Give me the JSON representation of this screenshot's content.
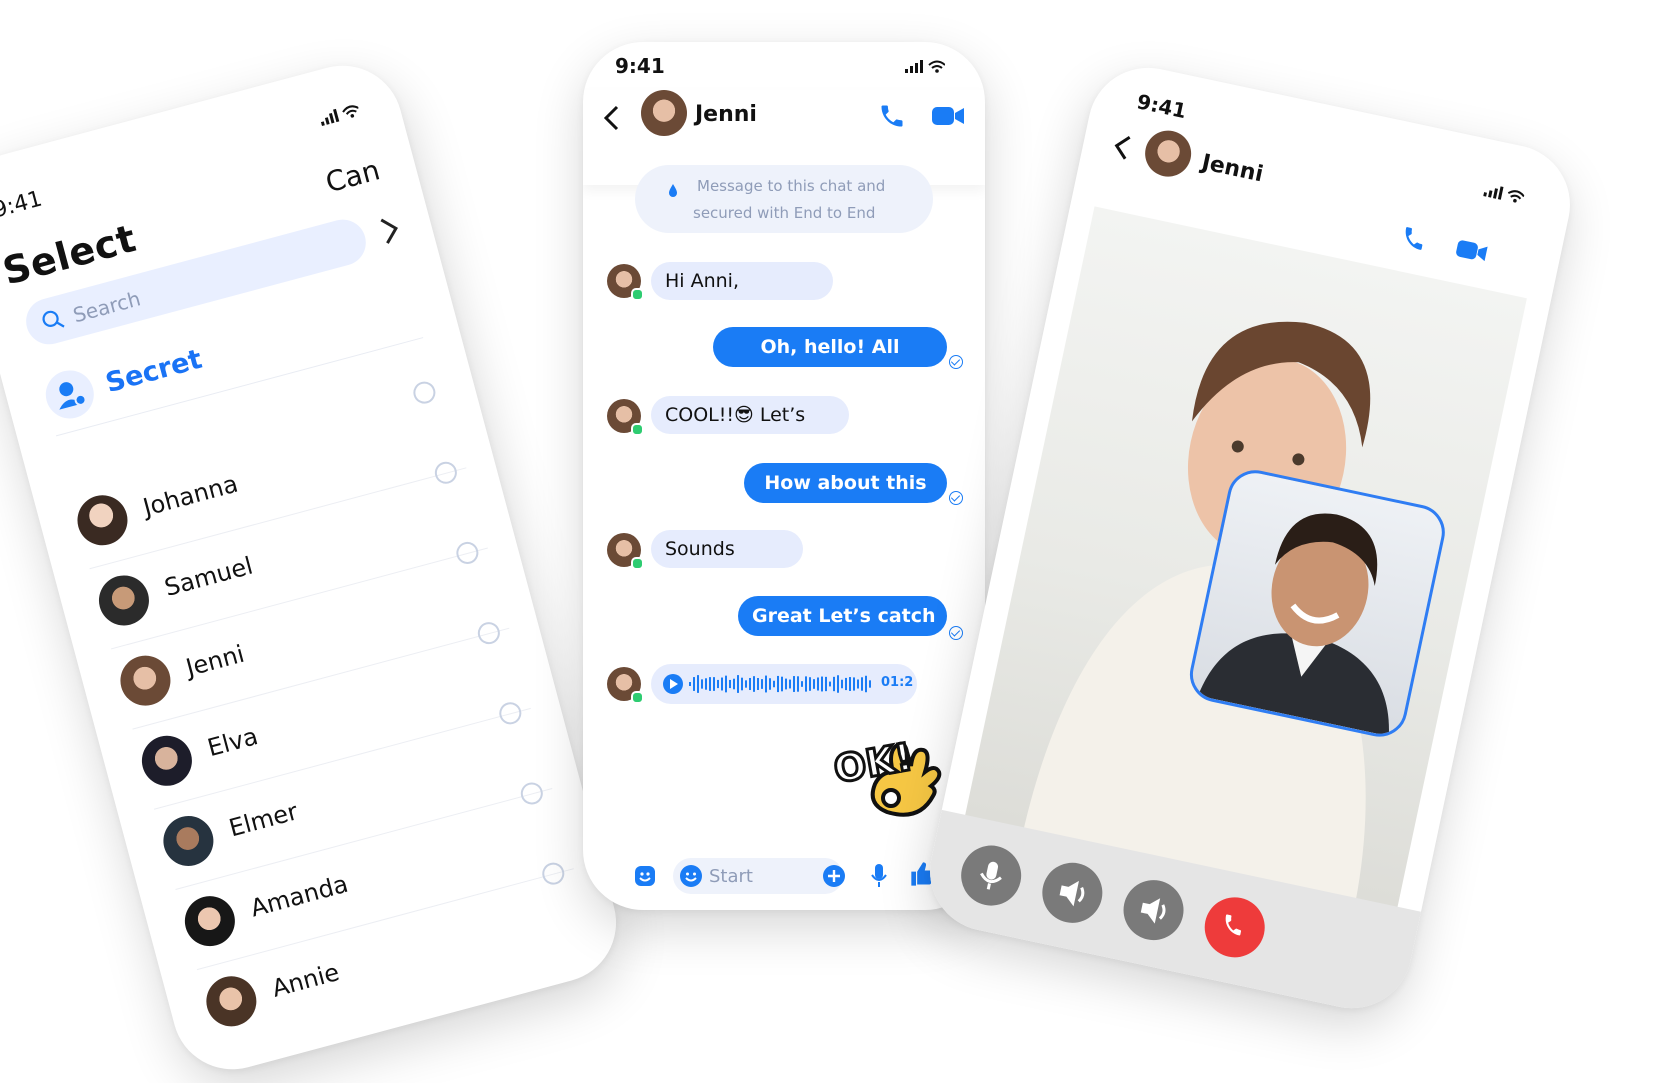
{
  "left_screen": {
    "time": "9:41",
    "title": "Select",
    "cancel_label": "Can",
    "search_placeholder": "Search",
    "secret_label": "Secret",
    "contacts": [
      {
        "name": "Johanna"
      },
      {
        "name": "Samuel"
      },
      {
        "name": "Jenni"
      },
      {
        "name": "Elva"
      },
      {
        "name": "Elmer"
      },
      {
        "name": "Amanda"
      },
      {
        "name": "Annie"
      }
    ]
  },
  "chat_screen": {
    "time": "9:41",
    "contact_name": "Jenni",
    "notice_line1": "Message to this chat and",
    "notice_line2": "secured with End to End",
    "messages": [
      {
        "direction": "in",
        "text": "Hi Anni,"
      },
      {
        "direction": "out",
        "text": "Oh, hello! All"
      },
      {
        "direction": "in",
        "text": "COOL!!😎 Let’s"
      },
      {
        "direction": "out",
        "text": "How about this"
      },
      {
        "direction": "in",
        "text": "Sounds"
      },
      {
        "direction": "out",
        "text": "Great Let’s catch"
      }
    ],
    "voice_duration": "01:2",
    "sticker_text": "OK!",
    "input_placeholder": "Start"
  },
  "call_screen": {
    "time": "9:41",
    "contact_name": "Jenni",
    "controls": [
      "mic-icon",
      "speaker-icon",
      "volume-icon",
      "end-call-icon"
    ]
  },
  "colors": {
    "accent": "#1a7cf5",
    "incoming_bubble": "#e6ecfd",
    "end_call": "#ee3b3b",
    "online": "#2ecc71"
  }
}
